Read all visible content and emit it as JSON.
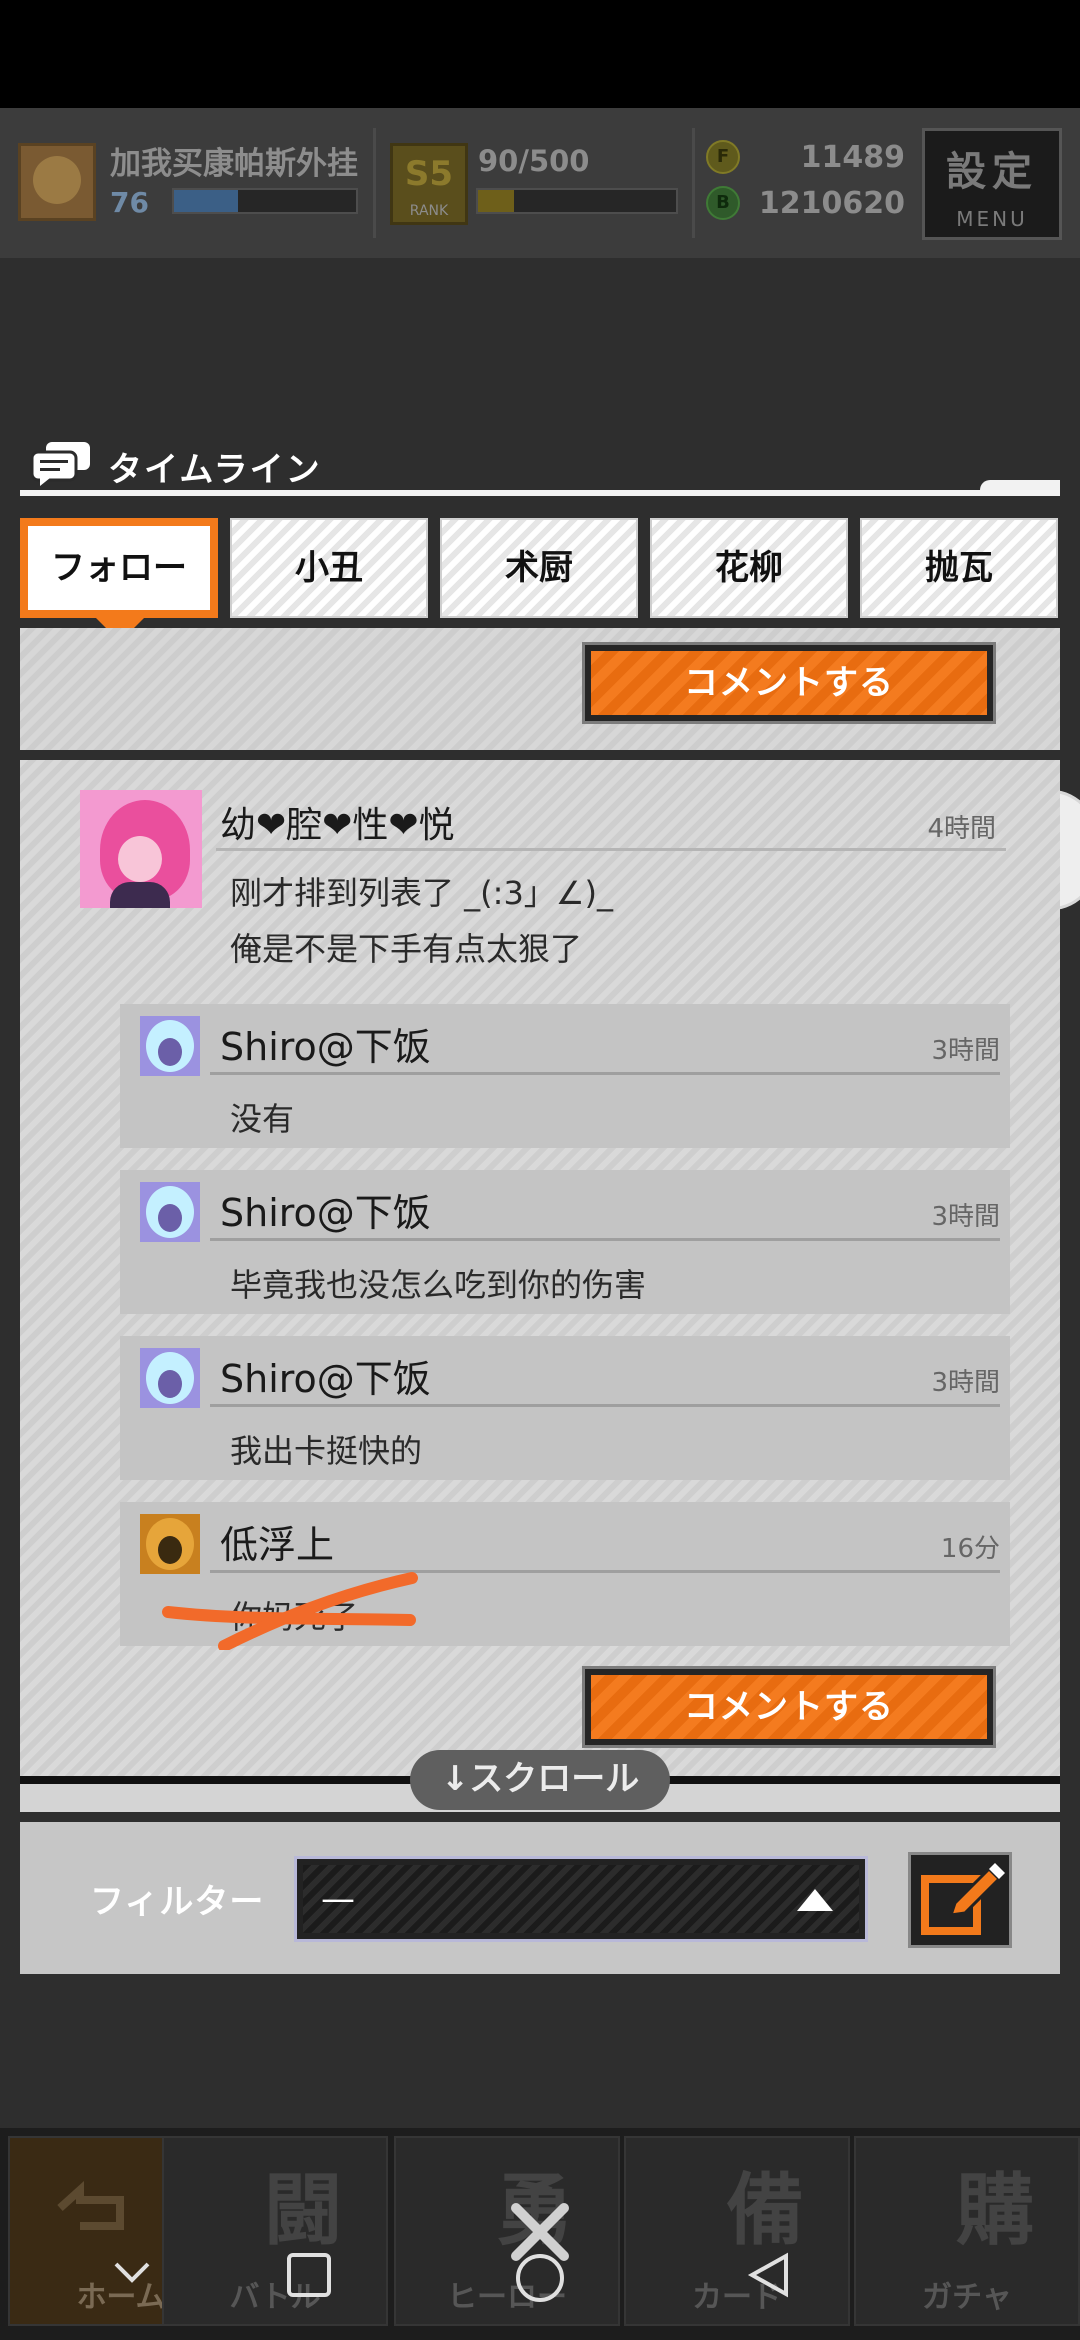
{
  "hud": {
    "player_name": "加我买康帕斯外挂",
    "player_level": "76",
    "level_progress": 0.35,
    "rank_badge": "S5",
    "rank_badge_sub": "RANK",
    "rank_points": "90/500",
    "rank_progress": 0.18,
    "coin_icon_letter": "F",
    "coin_count": "11489",
    "gem_icon_letter": "B",
    "gem_count": "1210620",
    "menu_big": "設定",
    "menu_small": "MENU"
  },
  "modal": {
    "title": "タイムライン",
    "tabs": [
      {
        "label": "フォロー",
        "active": true
      },
      {
        "label": "小丑",
        "active": false
      },
      {
        "label": "术厨",
        "active": false
      },
      {
        "label": "花柳",
        "active": false
      },
      {
        "label": "抛瓦",
        "active": false
      }
    ],
    "comment_button_label": "コメントする",
    "post": {
      "author": "幼❤腔❤性❤悦",
      "time": "4時間",
      "text_line1": "刚才排到列表了 _(:3」∠)_",
      "text_line2": "俺是不是下手有点太狠了"
    },
    "replies": [
      {
        "author": "Shiro@下饭",
        "time": "3時間",
        "text": "没有"
      },
      {
        "author": "Shiro@下饭",
        "time": "3時間",
        "text": "毕竟我也没怎么吃到你的伤害"
      },
      {
        "author": "Shiro@下饭",
        "time": "3時間",
        "text": "我出卡挺快的"
      },
      {
        "author": "低浮上",
        "time": "16分",
        "text": "你妈死了"
      }
    ],
    "scroll_hint": "↓スクロール",
    "filter_label": "フィルター",
    "filter_value": "—"
  },
  "bottom_nav": [
    {
      "label": "ホーム",
      "kanji": ""
    },
    {
      "label": "バトル",
      "kanji": "闘"
    },
    {
      "label": "ヒーロー",
      "kanji": "勇"
    },
    {
      "label": "カード",
      "kanji": "備"
    },
    {
      "label": "ガチャ",
      "kanji": "購"
    }
  ],
  "colors": {
    "accent_orange": "#f37a1b",
    "panel_gray": "#d4d4d4",
    "dark": "#222222"
  }
}
